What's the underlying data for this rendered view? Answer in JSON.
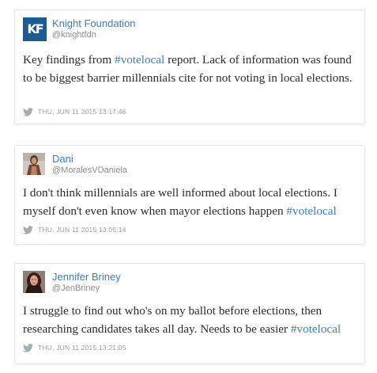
{
  "tweets": [
    {
      "name": "Knight Foundation",
      "handle": "@knightfdn",
      "avatar_text": "KF",
      "text_before": "Key findings from ",
      "hashtag": "#votelocal",
      "text_after": " report. Lack of information was found to be biggest barrier millennials cite for not voting in local elections.",
      "timestamp": "THU, JUN 11 2015 13:17:46"
    },
    {
      "name": "Dani",
      "handle": "@MoralesVDaniela",
      "text_before": "I don't think millennials are well informed about local elections. I myself don't even know when mayor elections happen ",
      "hashtag": "#votelocal",
      "text_after": "",
      "timestamp": "THU, JUN 11 2015 13:05:14"
    },
    {
      "name": "Jennifer Briney",
      "handle": "@JenBriney",
      "text_before": "I struggle to find out who's on my ballot before elections, then researching candidates takes all day. Needs to be easier ",
      "hashtag": "#votelocal",
      "text_after": "",
      "timestamp": "THU, JUN 11 2015 13:21:05"
    }
  ],
  "colors": {
    "link": "#3b7fc1",
    "brand": "#1c5b91",
    "meta": "#999ea2",
    "border": "#e3e6e8"
  },
  "icons": {
    "timestamp_icon": "twitter-bird-icon"
  }
}
